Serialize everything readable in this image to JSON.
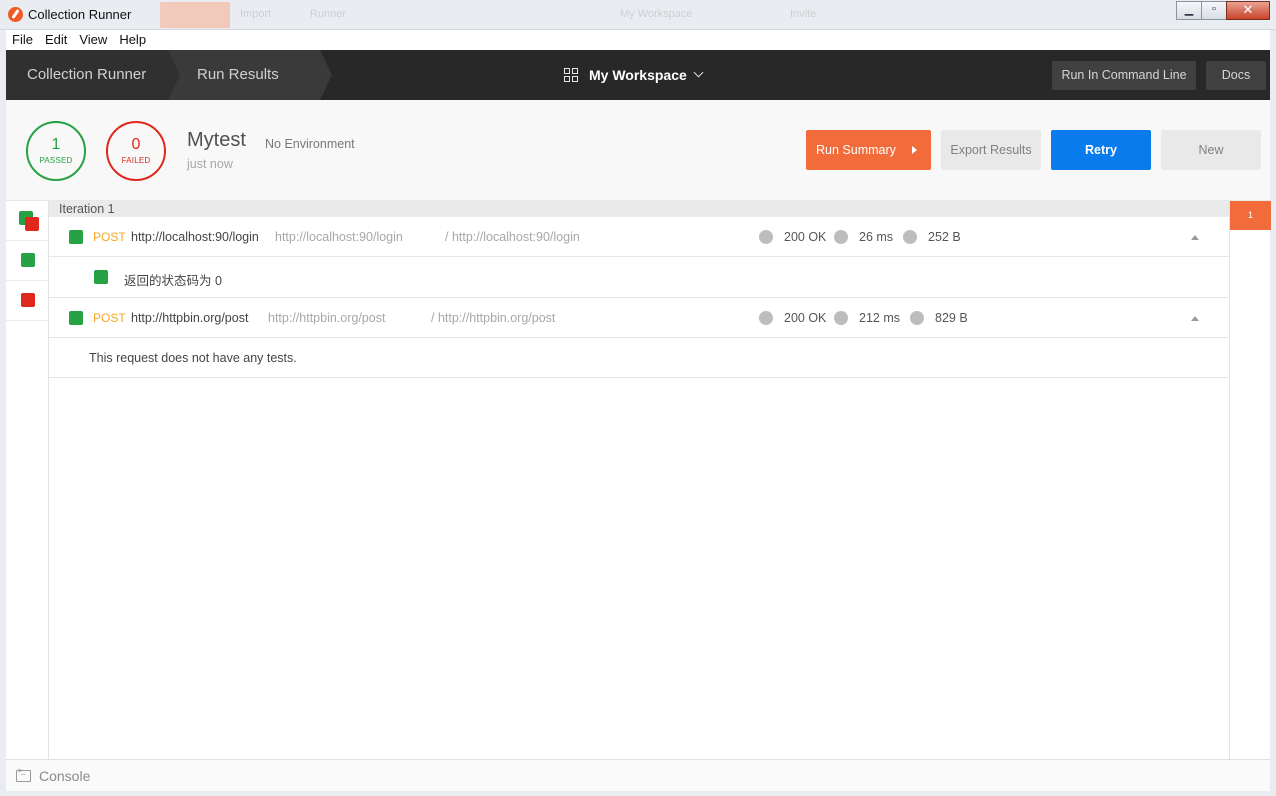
{
  "window": {
    "title": "Collection Runner",
    "ghost_items": [
      "New",
      "Import",
      "Runner",
      "My Workspace",
      "Invite"
    ]
  },
  "menu": [
    "File",
    "Edit",
    "View",
    "Help"
  ],
  "header": {
    "breadcrumb": [
      "Collection Runner",
      "Run Results"
    ],
    "workspace": "My Workspace",
    "run_cmd_label": "Run In Command Line",
    "docs_label": "Docs"
  },
  "summary": {
    "passed_count": "1",
    "passed_label": "PASSED",
    "failed_count": "0",
    "failed_label": "FAILED",
    "run_name": "Mytest",
    "environment": "No Environment",
    "when": "just now",
    "buttons": {
      "run_summary": "Run Summary",
      "export": "Export Results",
      "retry": "Retry",
      "new": "New"
    }
  },
  "iteration_label": "Iteration 1",
  "requests": [
    {
      "method": "POST",
      "name": "http://localhost:90/login",
      "url": "http://localhost:90/login",
      "path": "/ http://localhost:90/login",
      "status": "200 OK",
      "time": "26 ms",
      "size": "252 B",
      "test": "返回的状态码为 0"
    },
    {
      "method": "POST",
      "name": "http://httpbin.org/post",
      "url": "http://httpbin.org/post",
      "path": "/ http://httpbin.org/post",
      "status": "200 OK",
      "time": "212 ms",
      "size": "829 B",
      "no_tests": "This request does not have any tests."
    }
  ],
  "iteration_badge": "1",
  "footer": {
    "console_label": "Console"
  },
  "colors": {
    "pass": "#26a244",
    "fail": "#e0281c",
    "accent_orange": "#f26b3a",
    "retry_blue": "#097bed",
    "method_post": "#f5a623"
  }
}
